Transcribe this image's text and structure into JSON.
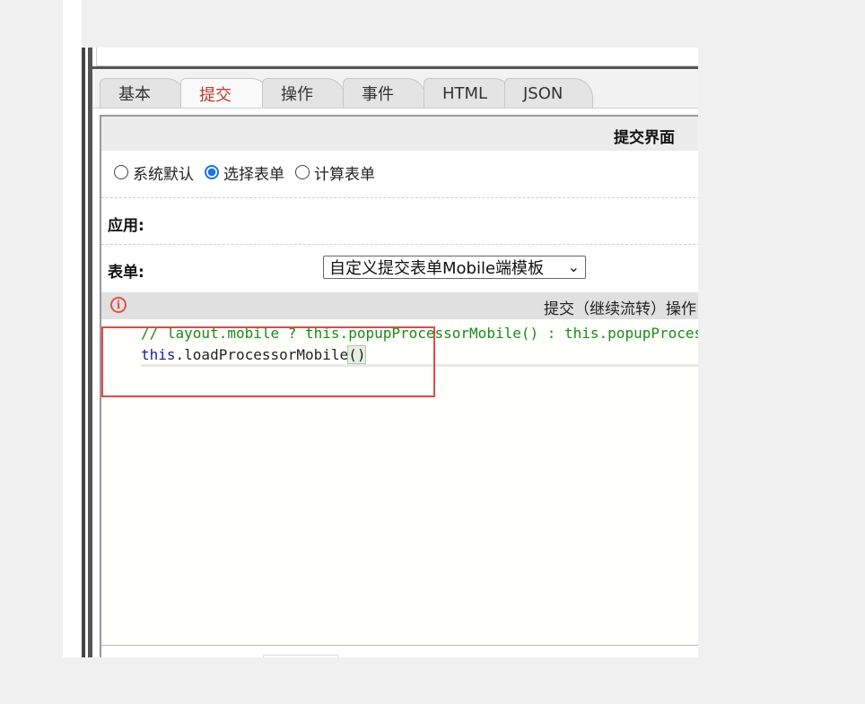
{
  "tabs": [
    {
      "label": "基本",
      "active": false
    },
    {
      "label": "提交",
      "active": true
    },
    {
      "label": "操作",
      "active": false
    },
    {
      "label": "事件",
      "active": false
    },
    {
      "label": "HTML",
      "active": false
    },
    {
      "label": "JSON",
      "active": false
    }
  ],
  "header": {
    "title": "提交界面"
  },
  "radio_options": [
    {
      "label": "系统默认",
      "checked": false
    },
    {
      "label": "选择表单",
      "checked": true
    },
    {
      "label": "计算表单",
      "checked": false
    }
  ],
  "fields": {
    "app_label": "应用:",
    "form_label": "表单:",
    "form_select_value": "自定义提交表单Mobile端模板"
  },
  "section": {
    "title": "提交（继续流转）操作"
  },
  "code": {
    "line1": "// layout.mobile ? this.popupProcessorMobile() : this.popupProcessor();",
    "line2_kw": "this",
    "line2_rest": ".loadProcessorMobile",
    "line2_paren": "()"
  },
  "colors": {
    "active_tab": "#c0392b",
    "radio_accent": "#1a73e8",
    "highlight": "#e04a4a",
    "comment": "#1a8a1a"
  }
}
